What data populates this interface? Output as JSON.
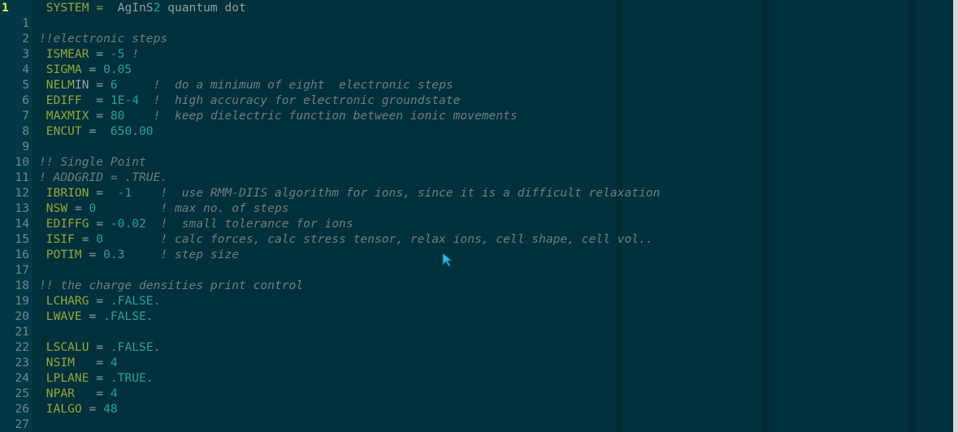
{
  "editor": {
    "current_line": "1",
    "lines": [
      {
        "n": "1",
        "parts": [
          {
            "t": " SYSTEM =  ",
            "c": "key"
          },
          {
            "t": "AgInS",
            "c": "txt"
          },
          {
            "t": "2",
            "c": "val"
          },
          {
            "t": " quantum dot",
            "c": "txt"
          }
        ]
      },
      {
        "n": "1",
        "parts": []
      },
      {
        "n": "2",
        "parts": [
          {
            "t": "!!electronic steps",
            "c": "cmt"
          }
        ]
      },
      {
        "n": "3",
        "parts": [
          {
            "t": " ISMEAR",
            "c": "key"
          },
          {
            "t": " = ",
            "c": "eq"
          },
          {
            "t": "-5",
            "c": "val"
          },
          {
            "t": " !",
            "c": "cmt"
          }
        ]
      },
      {
        "n": "4",
        "parts": [
          {
            "t": " SIGMA",
            "c": "key"
          },
          {
            "t": " = ",
            "c": "eq"
          },
          {
            "t": "0.05",
            "c": "val"
          }
        ]
      },
      {
        "n": "5",
        "parts": [
          {
            "t": " NELM",
            "c": "key"
          },
          {
            "t": "IN",
            "c": "txt"
          },
          {
            "t": " = ",
            "c": "eq"
          },
          {
            "t": "6",
            "c": "val"
          },
          {
            "t": "     !  do a minimum of eight  electronic steps",
            "c": "cmt"
          }
        ]
      },
      {
        "n": "6",
        "parts": [
          {
            "t": " EDIFF",
            "c": "key"
          },
          {
            "t": "  = ",
            "c": "eq"
          },
          {
            "t": "1E-4",
            "c": "val"
          },
          {
            "t": "  !  high accuracy for electronic groundstate",
            "c": "cmt"
          }
        ]
      },
      {
        "n": "7",
        "parts": [
          {
            "t": " MAXMIX",
            "c": "key"
          },
          {
            "t": " = ",
            "c": "eq"
          },
          {
            "t": "80",
            "c": "val"
          },
          {
            "t": "    !  keep dielectric function between ionic movements",
            "c": "cmt"
          }
        ]
      },
      {
        "n": "8",
        "parts": [
          {
            "t": " ENCUT",
            "c": "key"
          },
          {
            "t": " =  ",
            "c": "eq"
          },
          {
            "t": "650.00",
            "c": "val"
          }
        ]
      },
      {
        "n": "9",
        "parts": []
      },
      {
        "n": "10",
        "parts": [
          {
            "t": "!! Single Point",
            "c": "cmt"
          }
        ]
      },
      {
        "n": "11",
        "parts": [
          {
            "t": "! ADDGRID = .TRUE.",
            "c": "cmt"
          }
        ]
      },
      {
        "n": "12",
        "parts": [
          {
            "t": " IBRION",
            "c": "key"
          },
          {
            "t": " =  ",
            "c": "eq"
          },
          {
            "t": "-1",
            "c": "val"
          },
          {
            "t": "    !  use RMM-DIIS algorithm for ions, since it is a difficult relaxation",
            "c": "cmt"
          }
        ]
      },
      {
        "n": "13",
        "parts": [
          {
            "t": " NSW",
            "c": "key"
          },
          {
            "t": " = ",
            "c": "eq"
          },
          {
            "t": "0",
            "c": "val"
          },
          {
            "t": "         ! max no. of steps",
            "c": "cmt"
          }
        ]
      },
      {
        "n": "14",
        "parts": [
          {
            "t": " EDIFFG",
            "c": "key"
          },
          {
            "t": " = ",
            "c": "eq"
          },
          {
            "t": "-0.02",
            "c": "val"
          },
          {
            "t": "  !  small tolerance for ions",
            "c": "cmt"
          }
        ]
      },
      {
        "n": "15",
        "parts": [
          {
            "t": " ISIF",
            "c": "key"
          },
          {
            "t": " = ",
            "c": "eq"
          },
          {
            "t": "0",
            "c": "val"
          },
          {
            "t": "        ! calc forces, calc stress tensor, relax ions, cell shape, cell vol..",
            "c": "cmt"
          }
        ]
      },
      {
        "n": "16",
        "parts": [
          {
            "t": " POTIM",
            "c": "key"
          },
          {
            "t": " = ",
            "c": "eq"
          },
          {
            "t": "0.3",
            "c": "val"
          },
          {
            "t": "     ! step size",
            "c": "cmt"
          }
        ]
      },
      {
        "n": "17",
        "parts": []
      },
      {
        "n": "18",
        "parts": [
          {
            "t": "!! the charge densities print control",
            "c": "cmt"
          }
        ]
      },
      {
        "n": "19",
        "parts": [
          {
            "t": " LCHARG",
            "c": "key"
          },
          {
            "t": " = ",
            "c": "eq"
          },
          {
            "t": ".FALSE.",
            "c": "val"
          }
        ]
      },
      {
        "n": "20",
        "parts": [
          {
            "t": " LWAVE",
            "c": "key"
          },
          {
            "t": " = ",
            "c": "eq"
          },
          {
            "t": ".FALSE.",
            "c": "val"
          }
        ]
      },
      {
        "n": "21",
        "parts": []
      },
      {
        "n": "22",
        "parts": [
          {
            "t": " LSCALU",
            "c": "key"
          },
          {
            "t": " = ",
            "c": "eq"
          },
          {
            "t": ".FALSE.",
            "c": "val"
          }
        ]
      },
      {
        "n": "23",
        "parts": [
          {
            "t": " NSIM",
            "c": "key"
          },
          {
            "t": "   = ",
            "c": "eq"
          },
          {
            "t": "4",
            "c": "val"
          }
        ]
      },
      {
        "n": "24",
        "parts": [
          {
            "t": " LPLANE",
            "c": "key"
          },
          {
            "t": " = ",
            "c": "eq"
          },
          {
            "t": ".TRUE.",
            "c": "val"
          }
        ]
      },
      {
        "n": "25",
        "parts": [
          {
            "t": " NPAR",
            "c": "key"
          },
          {
            "t": "   = ",
            "c": "eq"
          },
          {
            "t": "4",
            "c": "val"
          }
        ]
      },
      {
        "n": "26",
        "parts": [
          {
            "t": " IALGO",
            "c": "key"
          },
          {
            "t": " = ",
            "c": "eq"
          },
          {
            "t": "48",
            "c": "val"
          }
        ]
      },
      {
        "n": "27",
        "parts": []
      }
    ]
  },
  "colors": {
    "background": "#00303c",
    "keyword": "#95a83a",
    "value": "#2aa198",
    "comment": "#6f7f80",
    "current_line_number": "#e8e84a"
  },
  "cursor_icon": "mouse-pointer-icon"
}
